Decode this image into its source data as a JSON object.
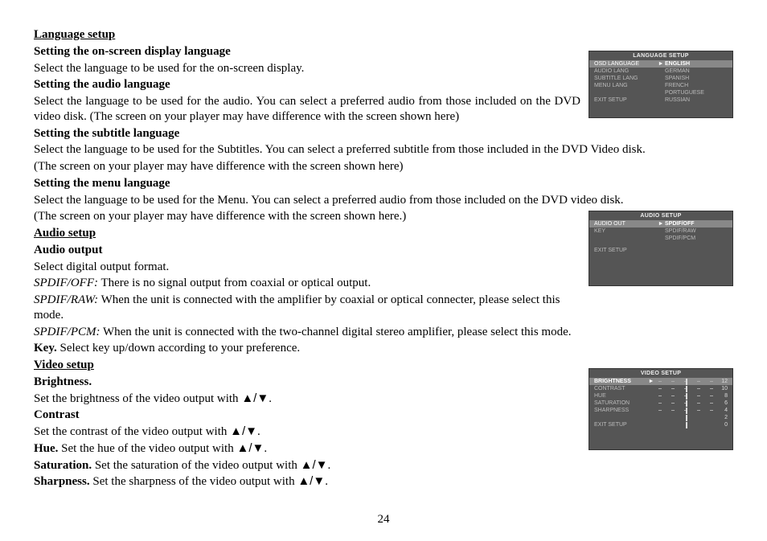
{
  "page_number": "24",
  "arrow_pair": "▲/▼",
  "body": {
    "language_setup": {
      "title": "Language setup",
      "osd": {
        "heading": "Setting the on-screen display language",
        "text": "Select the language to be used for the on-screen display."
      },
      "audio": {
        "heading": "Setting the audio language",
        "text": "Select the language to be used for the audio. You can select a preferred audio from those included on the DVD video disk. (The screen on your player may have difference with the screen shown here)"
      },
      "subtitle": {
        "heading": "Setting the subtitle language",
        "text1": "Select the language to be used for the Subtitles. You can select a preferred subtitle from those included in the DVD Video disk.",
        "text2": "(The screen on your player may have difference with the screen shown here)"
      },
      "menu": {
        "heading": "Setting the menu language",
        "text1": "Select the language to be used for the Menu. You can select a preferred audio from those included on the DVD video disk.",
        "text2": "(The screen on your player may have difference with the screen shown here.)"
      }
    },
    "audio_setup": {
      "title": "Audio setup",
      "output": {
        "heading": "Audio output",
        "select": "Select digital output format.",
        "off_label": "SPDIF/OFF:",
        "off_text": " There is no signal output from coaxial or optical output.",
        "raw_label": "SPDIF/RAW:",
        "raw_text": " When the unit is connected with the amplifier by coaxial or optical connecter, please select this mode.",
        "pcm_label": "SPDIF/PCM:",
        "pcm_text": " When the unit is connected with the two-channel digital stereo amplifier, please select this mode.",
        "key_label": "Key.",
        "key_text": " Select key up/down according to your preference."
      }
    },
    "video_setup": {
      "title": "Video setup",
      "brightness": {
        "label": "Brightness.",
        "text": "Set the brightness of the video output with "
      },
      "contrast": {
        "label": "Contrast",
        "text": "Set the contrast of the video output with "
      },
      "hue": {
        "label": "Hue.",
        "text": " Set the hue of the video output with "
      },
      "saturation": {
        "label": "Saturation.",
        "text": " Set the saturation of the video output with "
      },
      "sharpness": {
        "label": "Sharpness.",
        "text": " Set the sharpness of the video output with "
      }
    }
  },
  "osd_lang": {
    "title": "LANGUAGE SETUP",
    "rows": {
      "osd": {
        "label": "OSD LANGUAGE",
        "value": "ENGLISH"
      },
      "audio": {
        "label": "AUDIO LANG",
        "value": "GERMAN"
      },
      "subtitle": {
        "label": "SUBTITLE LANG",
        "value": "SPANISH"
      },
      "menu": {
        "label": "MENU LANG",
        "value": "FRENCH"
      },
      "portuguese": "PORTUGUESE",
      "russian": "RUSSIAN",
      "exit": "EXIT  SETUP"
    }
  },
  "osd_audio": {
    "title": "AUDIO SETUP",
    "rows": {
      "out": {
        "label": "AUDIO OUT",
        "value": "SPDIF/OFF"
      },
      "key": {
        "label": "KEY",
        "value": "SPDIF/RAW"
      },
      "pcm": "SPDIF/PCM",
      "exit": "EXIT  SETUP"
    }
  },
  "osd_video": {
    "title": "VIDEO SETUP",
    "rows": {
      "brightness": {
        "label": "BRIGHTNESS",
        "num": "12"
      },
      "contrast": {
        "label": "CONTRAST",
        "num": "10"
      },
      "hue": {
        "label": "HUE",
        "num": "8"
      },
      "saturation": {
        "label": "SATURATION",
        "num": "6"
      },
      "sharpness": {
        "label": "SHARPNESS",
        "num": "4"
      },
      "spacer2": "2",
      "spacer0": "0",
      "exit": "EXIT  SETUP"
    }
  }
}
